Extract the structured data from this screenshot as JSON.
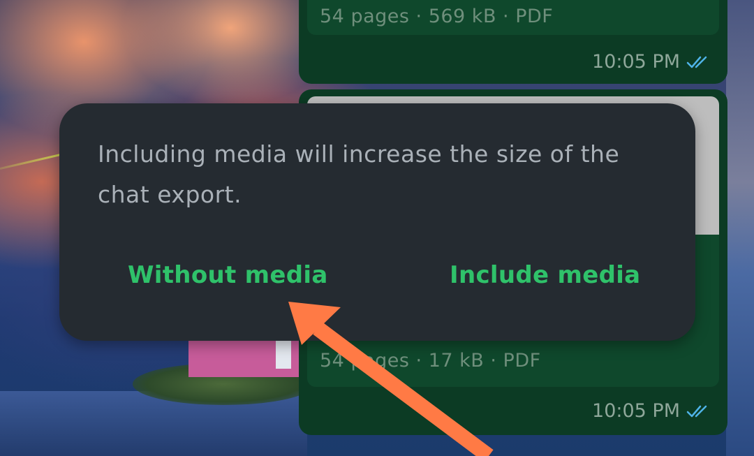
{
  "chat": {
    "messages": [
      {
        "doc_meta": "54 pages · 569 kB · PDF",
        "time": "10:05 PM",
        "status_icon": "double-check-icon"
      },
      {
        "doc_meta": "54 pages · 17 kB · PDF",
        "time": "10:05 PM",
        "status_icon": "double-check-icon"
      }
    ]
  },
  "dialog": {
    "message": "Including media will increase the size of the chat export.",
    "buttons": {
      "without_media": "Without media",
      "include_media": "Include media"
    }
  },
  "annotation": {
    "arrow_color": "#ff7a45",
    "target": "without_media"
  },
  "colors": {
    "accent": "#2fc26a",
    "bubble": "#0c3b24",
    "dialog_bg": "#252b31",
    "read_ticks": "#4fb3e8"
  }
}
